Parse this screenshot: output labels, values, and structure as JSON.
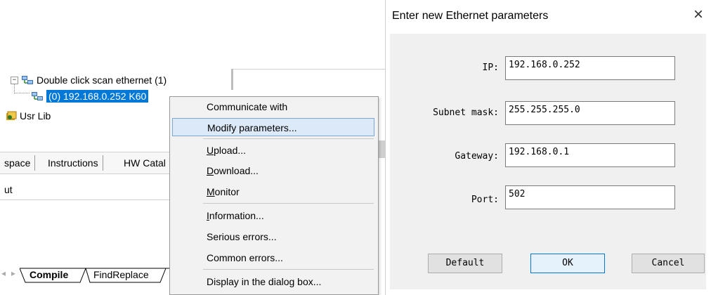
{
  "tree": {
    "root_label": "Double click scan ethernet (1)",
    "child_label": "(0) 192.168.0.252 K60",
    "usr_lib_label": "Usr Lib"
  },
  "tabs": [
    "space",
    "Instructions",
    "HW Catal"
  ],
  "column_header": "ut",
  "bottom_tabs": [
    "Compile",
    "FindReplace"
  ],
  "context_menu": {
    "items": [
      {
        "label": "Communicate with",
        "underline": ""
      },
      {
        "label": "Modify parameters...",
        "underline": ""
      },
      {
        "label": "Upload...",
        "underline": "U"
      },
      {
        "label": "Download...",
        "underline": "D"
      },
      {
        "label": "Monitor",
        "underline": "M"
      },
      {
        "label": "Information...",
        "underline": "I"
      },
      {
        "label": "Serious errors...",
        "underline": ""
      },
      {
        "label": "Common errors...",
        "underline": ""
      },
      {
        "label": "Display in the dialog box...",
        "underline": ""
      }
    ],
    "highlighted": "Modify parameters..."
  },
  "dialog": {
    "title": "Enter new Ethernet parameters",
    "close_glyph": "×",
    "fields": {
      "ip_label": "IP:",
      "ip_value": "192.168.0.252",
      "subnet_label": "Subnet mask:",
      "subnet_value": "255.255.255.0",
      "gateway_label": "Gateway:",
      "gateway_value": "192.168.0.1",
      "port_label": "Port:",
      "port_value": "502"
    },
    "buttons": {
      "default": "Default",
      "ok": "OK",
      "cancel": "Cancel"
    }
  },
  "colors": {
    "selection": "#0078d7",
    "menu_highlight": "#dbe9f8",
    "dialog_body": "#f0f0f0"
  }
}
